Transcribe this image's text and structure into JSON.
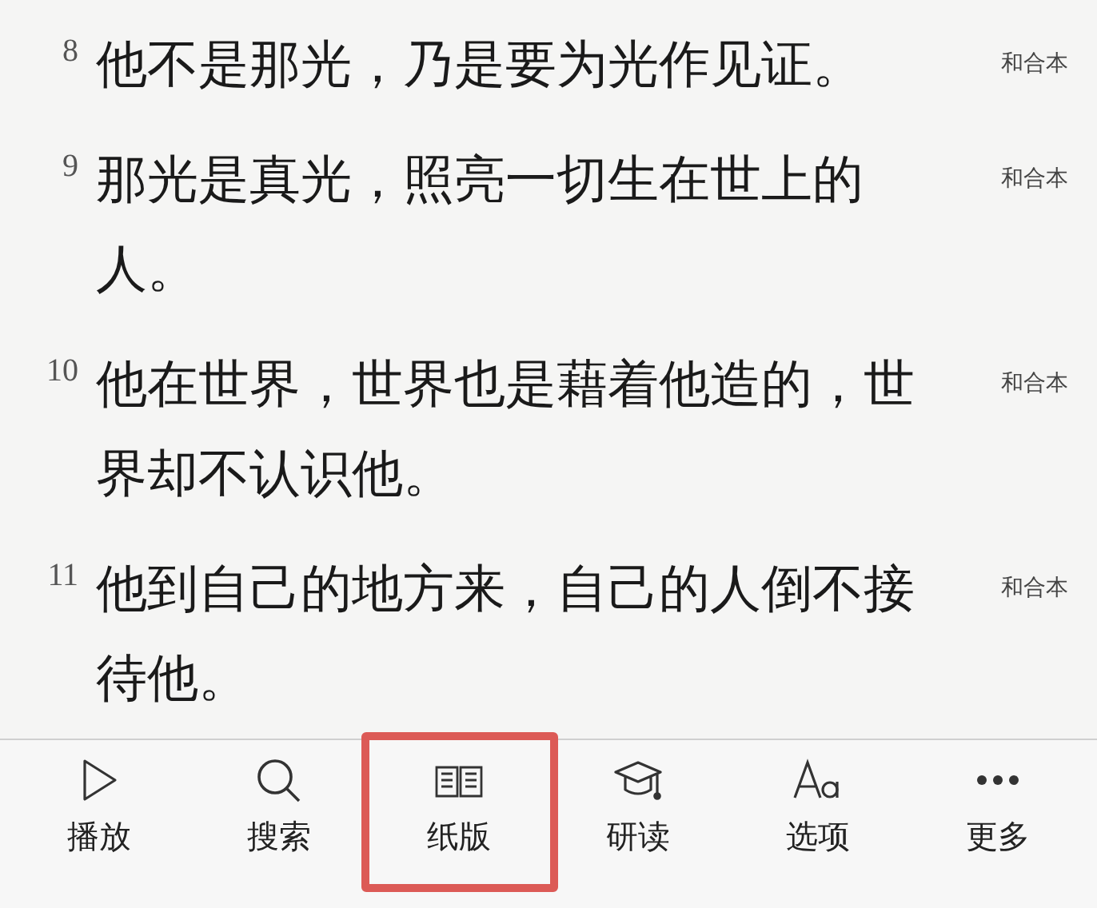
{
  "verses": [
    {
      "number": "8",
      "text": "他不是那光，乃是要为光作见证。",
      "version": "和合本"
    },
    {
      "number": "9",
      "text": "那光是真光，照亮一切生在世上的人。",
      "version": "和合本"
    },
    {
      "number": "10",
      "text": "他在世界，世界也是藉着他造的，世界却不认识他。",
      "version": "和合本"
    },
    {
      "number": "11",
      "text": "他到自己的地方来，自己的人倒不接待他。",
      "version": "和合本"
    }
  ],
  "toolbar": [
    {
      "kind": "play",
      "label": "播放",
      "highlighted": false
    },
    {
      "kind": "search",
      "label": "搜索",
      "highlighted": false
    },
    {
      "kind": "book",
      "label": "纸版",
      "highlighted": true
    },
    {
      "kind": "study",
      "label": "研读",
      "highlighted": false
    },
    {
      "kind": "font",
      "label": "选项",
      "highlighted": false
    },
    {
      "kind": "more",
      "label": "更多",
      "highlighted": false
    }
  ]
}
